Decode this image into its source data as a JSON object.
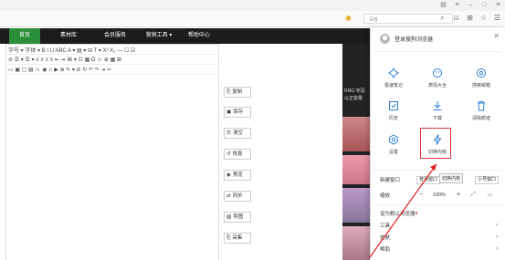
{
  "browser": {
    "search_placeholder": "百度"
  },
  "site_nav": {
    "items": [
      "首页",
      "素材库",
      "会员服务",
      "营销工具 ▾",
      "帮助中心"
    ]
  },
  "editor": {
    "toolbar_row1": "字号 ▾  字体 ▾   B  I  U  ABC  A ▾  ▤ ▾  ⊟  T ▾  X²  X₂  —  ☐  ☑",
    "toolbar_row2": "⊘  ☰ ▾  ☰ ▾  ≡  ≡  ≡  ≡  ⇤  ⇥  ⌘ ▾  ☷  ▦  Ω  ☺  ⊕  ▦  ⊞",
    "toolbar_row3": "▭  ▣  ▢  ▤  ☺  ◉  ♫  ▶  ⊕  ✎ ▾  ⊘  ↻  ↶  ↷  ⇥  ✂"
  },
  "side_buttons": [
    "复制",
    "保存",
    "清空",
    "恢复",
    "预览",
    "同步",
    "导图",
    "采集"
  ],
  "video_strip": {
    "text1": "RNG 夺冠",
    "text2": "以正能量"
  },
  "panel": {
    "login_text": "登录搜狗浏览器",
    "grid": [
      {
        "label": "极速笔记"
      },
      {
        "label": "表情大全"
      },
      {
        "label": "搜索邮箱"
      },
      {
        "label": "历史"
      },
      {
        "label": "下载"
      },
      {
        "label": "清除痕迹"
      },
      {
        "label": "设置"
      },
      {
        "label": "切换内核"
      }
    ],
    "tooltip": "切换内核",
    "new_window_label": "新建窗口",
    "new_window_btn": "普通窗口",
    "mini_window_btn": "小号窗口",
    "zoom_label": "缩放",
    "zoom_minus": "−",
    "zoom_value": "100%",
    "zoom_plus": "+",
    "set_default": "设为默认浏览器",
    "menu_tools": "工具",
    "menu_skin": "皮肤",
    "menu_help": "帮助"
  }
}
